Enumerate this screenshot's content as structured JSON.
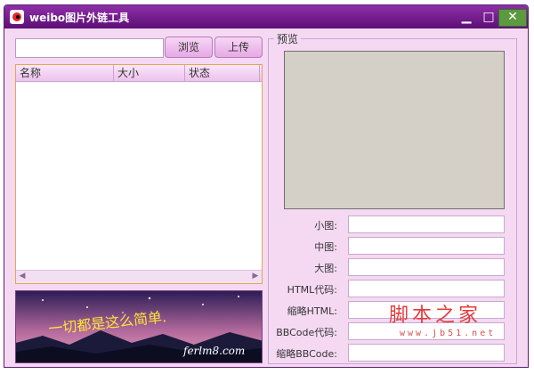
{
  "window": {
    "title": "weibo图片外链工具"
  },
  "toolbar": {
    "browse_label": "浏览",
    "upload_label": "上传"
  },
  "file_list": {
    "columns": [
      "名称",
      "大小",
      "状态"
    ]
  },
  "banner": {
    "slogan": "一切都是这么简单.",
    "site": "ferlm8.com"
  },
  "preview_group": {
    "label": "预览"
  },
  "fields": [
    {
      "label": "小图:"
    },
    {
      "label": "中图:"
    },
    {
      "label": "大图:"
    },
    {
      "label": "HTML代码:"
    },
    {
      "label": "缩略HTML:"
    },
    {
      "label": "BBCode代码:"
    },
    {
      "label": "缩略BBCode:"
    }
  ],
  "watermark": {
    "main": "脚本之家",
    "sub": "www.jb51.net"
  },
  "colors": {
    "titlebar": "#6a1785",
    "window_bg": "#f5d9f2",
    "close_button": "#5b9a3e"
  }
}
